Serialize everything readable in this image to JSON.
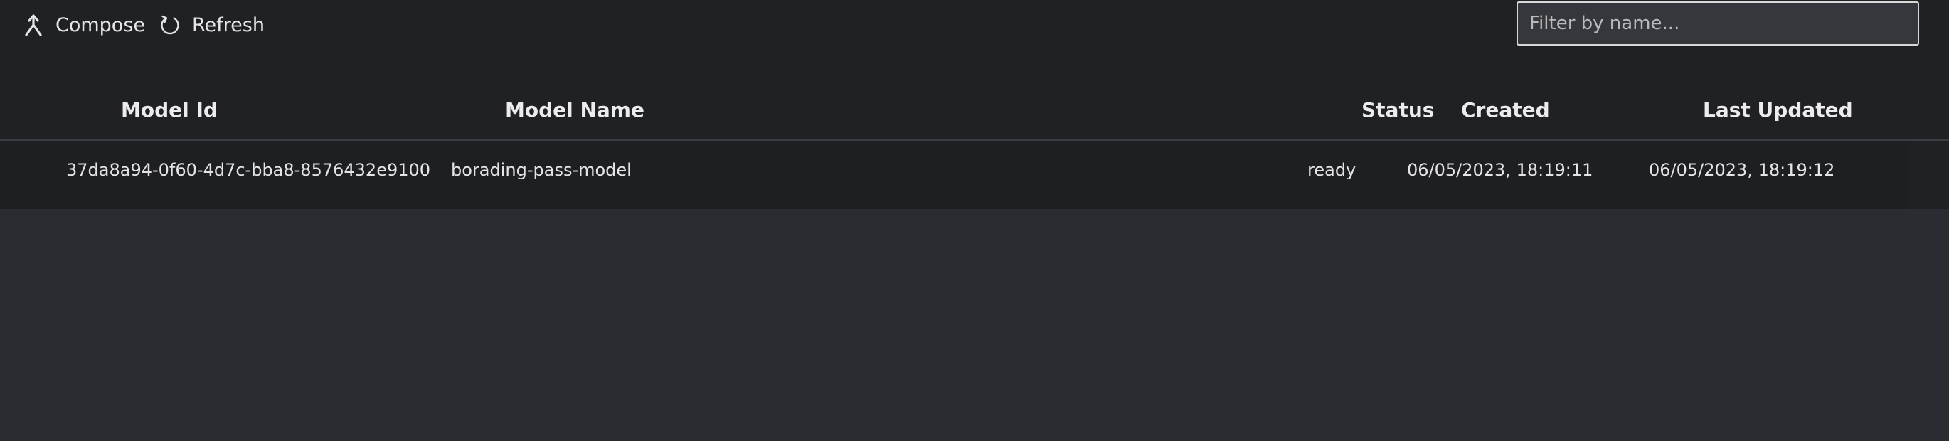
{
  "toolbar": {
    "compose_label": "Compose",
    "refresh_label": "Refresh",
    "filter_placeholder": "Filter by name..."
  },
  "table": {
    "columns": [
      "Model Id",
      "Model Name",
      "Status",
      "Created",
      "Last Updated"
    ],
    "rows": [
      {
        "model_id": "37da8a94-0f60-4d7c-bba8-8576432e9100",
        "model_name": "borading-pass-model",
        "status": "ready",
        "created": "06/05/2023, 18:19:11",
        "last_updated": "06/05/2023, 18:19:12"
      }
    ]
  },
  "icons": {
    "compose": "merge-arrow-icon",
    "refresh": "refresh-icon"
  }
}
